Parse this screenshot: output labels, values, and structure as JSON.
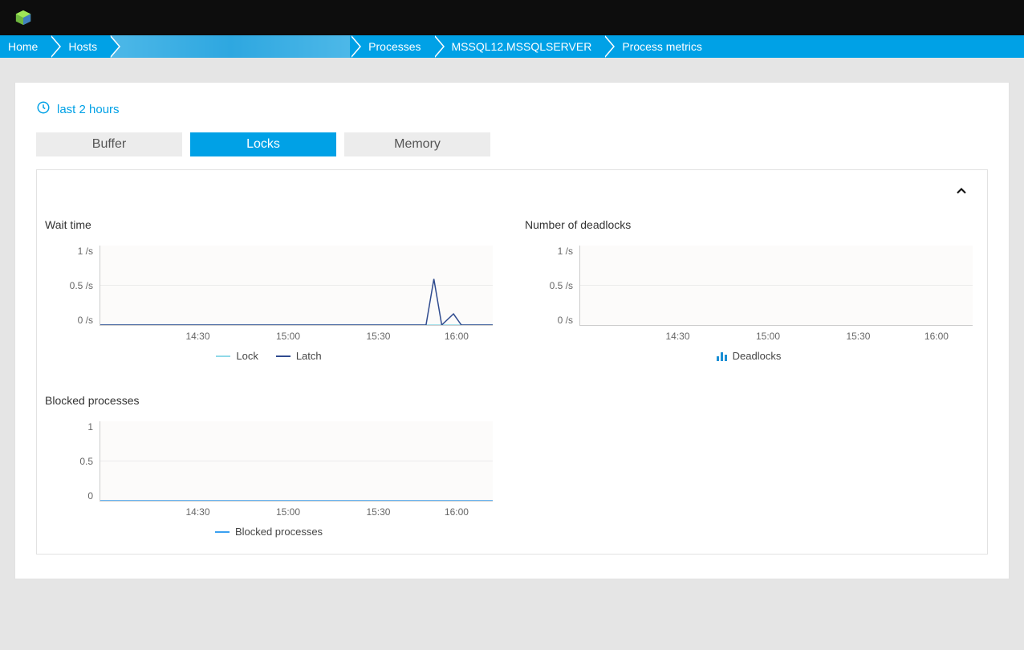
{
  "breadcrumb": {
    "home": "Home",
    "hosts": "Hosts",
    "host": "",
    "processes": "Processes",
    "process": "MSSQL12.MSSQLSERVER",
    "metrics": "Process metrics"
  },
  "time_range": {
    "label": "last 2 hours"
  },
  "tabs": {
    "buffer": "Buffer",
    "locks": "Locks",
    "memory": "Memory",
    "active": "locks"
  },
  "colors": {
    "accent": "#00a1e6",
    "lock_line": "#8fd9e8",
    "latch_line": "#2f4b8f",
    "blocked_line": "#3aa0f0",
    "deadlock_bar": "#1a8fd4"
  },
  "chart_data": [
    {
      "id": "wait_time",
      "type": "line",
      "title": "Wait time",
      "ylabel": "/s",
      "ylim": [
        0,
        1
      ],
      "y_ticks": [
        "1 /s",
        "0.5 /s",
        "0 /s"
      ],
      "x_ticks": [
        "14:30",
        "15:00",
        "15:30",
        "16:00"
      ],
      "x_range": [
        "14:00",
        "16:00"
      ],
      "series": [
        {
          "name": "Lock",
          "color": "#8fd9e8",
          "points": [
            {
              "t": "14:00",
              "v": 0
            },
            {
              "t": "14:30",
              "v": 0
            },
            {
              "t": "15:00",
              "v": 0
            },
            {
              "t": "15:30",
              "v": 0
            },
            {
              "t": "16:00",
              "v": 0
            }
          ]
        },
        {
          "name": "Latch",
          "color": "#2f4b8f",
          "points": [
            {
              "t": "14:00",
              "v": 0
            },
            {
              "t": "14:30",
              "v": 0
            },
            {
              "t": "15:00",
              "v": 0
            },
            {
              "t": "15:30",
              "v": 0
            },
            {
              "t": "15:40",
              "v": 0
            },
            {
              "t": "15:42",
              "v": 0.58
            },
            {
              "t": "15:44",
              "v": 0
            },
            {
              "t": "15:48",
              "v": 0.14
            },
            {
              "t": "15:50",
              "v": 0
            },
            {
              "t": "16:00",
              "v": 0
            }
          ]
        }
      ],
      "legend": [
        {
          "name": "Lock",
          "color": "#8fd9e8"
        },
        {
          "name": "Latch",
          "color": "#2f4b8f"
        }
      ]
    },
    {
      "id": "deadlocks",
      "type": "bar",
      "title": "Number of deadlocks",
      "ylabel": "/s",
      "ylim": [
        0,
        1
      ],
      "y_ticks": [
        "1 /s",
        "0.5 /s",
        "0 /s"
      ],
      "x_ticks": [
        "14:30",
        "15:00",
        "15:30",
        "16:00"
      ],
      "x_range": [
        "14:00",
        "16:00"
      ],
      "series": [
        {
          "name": "Deadlocks",
          "color": "#1a8fd4",
          "points": [
            {
              "t": "14:00",
              "v": 0
            },
            {
              "t": "14:30",
              "v": 0
            },
            {
              "t": "15:00",
              "v": 0
            },
            {
              "t": "15:30",
              "v": 0
            },
            {
              "t": "16:00",
              "v": 0
            }
          ]
        }
      ],
      "legend": [
        {
          "name": "Deadlocks",
          "color": "#1a8fd4",
          "style": "bar"
        }
      ]
    },
    {
      "id": "blocked_processes",
      "type": "line",
      "title": "Blocked processes",
      "ylabel": "",
      "ylim": [
        0,
        1
      ],
      "y_ticks": [
        "1",
        "0.5",
        "0"
      ],
      "x_ticks": [
        "14:30",
        "15:00",
        "15:30",
        "16:00"
      ],
      "x_range": [
        "14:00",
        "16:00"
      ],
      "series": [
        {
          "name": "Blocked processes",
          "color": "#3aa0f0",
          "points": [
            {
              "t": "14:00",
              "v": 0
            },
            {
              "t": "14:30",
              "v": 0
            },
            {
              "t": "15:00",
              "v": 0
            },
            {
              "t": "15:30",
              "v": 0
            },
            {
              "t": "16:00",
              "v": 0
            }
          ]
        }
      ],
      "legend": [
        {
          "name": "Blocked processes",
          "color": "#3aa0f0"
        }
      ]
    }
  ]
}
